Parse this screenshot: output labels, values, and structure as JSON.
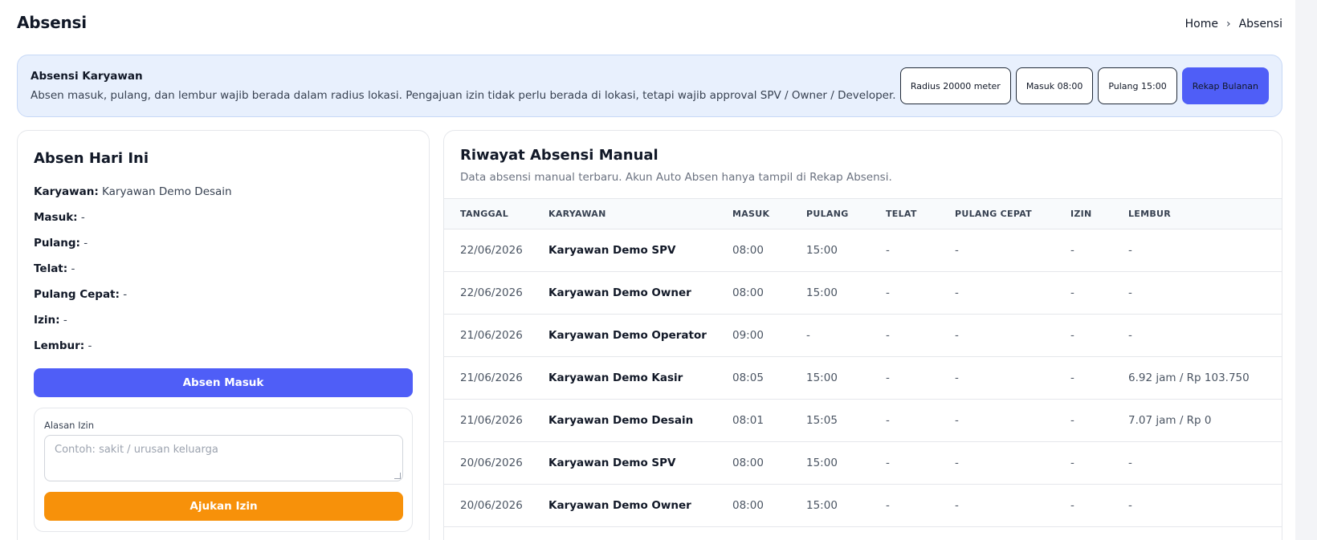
{
  "header": {
    "title": "Absensi",
    "breadcrumb": {
      "home": "Home",
      "current": "Absensi"
    }
  },
  "info": {
    "title": "Absensi Karyawan",
    "description": "Absen masuk, pulang, dan lembur wajib berada dalam radius lokasi. Pengajuan izin tidak perlu berada di lokasi, tetapi wajib approval SPV / Owner / Developer.",
    "radius": "Radius 20000 meter",
    "masuk": "Masuk 08:00",
    "pulang": "Pulang 15:00",
    "rekap": "Rekap Bulanan"
  },
  "today": {
    "title": "Absen Hari Ini",
    "fields": [
      {
        "label": "Karyawan:",
        "value": "Karyawan Demo Desain"
      },
      {
        "label": "Masuk:",
        "value": "-"
      },
      {
        "label": "Pulang:",
        "value": "-"
      },
      {
        "label": "Telat:",
        "value": "-"
      },
      {
        "label": "Pulang Cepat:",
        "value": "-"
      },
      {
        "label": "Izin:",
        "value": "-"
      },
      {
        "label": "Lembur:",
        "value": "-"
      }
    ],
    "absen_button": "Absen Masuk",
    "izin_label": "Alasan Izin",
    "izin_placeholder": "Contoh: sakit / urusan keluarga",
    "izin_button": "Ajukan Izin"
  },
  "history": {
    "title": "Riwayat Absensi Manual",
    "subtitle": "Data absensi manual terbaru. Akun Auto Absen hanya tampil di Rekap Absensi.",
    "columns": [
      "TANGGAL",
      "KARYAWAN",
      "MASUK",
      "PULANG",
      "TELAT",
      "PULANG CEPAT",
      "IZIN",
      "LEMBUR"
    ],
    "rows": [
      [
        "22/06/2026",
        "Karyawan Demo SPV",
        "08:00",
        "15:00",
        "-",
        "-",
        "-",
        "-"
      ],
      [
        "22/06/2026",
        "Karyawan Demo Owner",
        "08:00",
        "15:00",
        "-",
        "-",
        "-",
        "-"
      ],
      [
        "21/06/2026",
        "Karyawan Demo Operator",
        "09:00",
        "-",
        "-",
        "-",
        "-",
        "-"
      ],
      [
        "21/06/2026",
        "Karyawan Demo Kasir",
        "08:05",
        "15:00",
        "-",
        "-",
        "-",
        "6.92 jam / Rp 103.750"
      ],
      [
        "21/06/2026",
        "Karyawan Demo Desain",
        "08:01",
        "15:05",
        "-",
        "-",
        "-",
        "7.07 jam / Rp 0"
      ],
      [
        "20/06/2026",
        "Karyawan Demo SPV",
        "08:00",
        "15:00",
        "-",
        "-",
        "-",
        "-"
      ],
      [
        "20/06/2026",
        "Karyawan Demo Owner",
        "08:00",
        "15:00",
        "-",
        "-",
        "-",
        "-"
      ]
    ]
  }
}
